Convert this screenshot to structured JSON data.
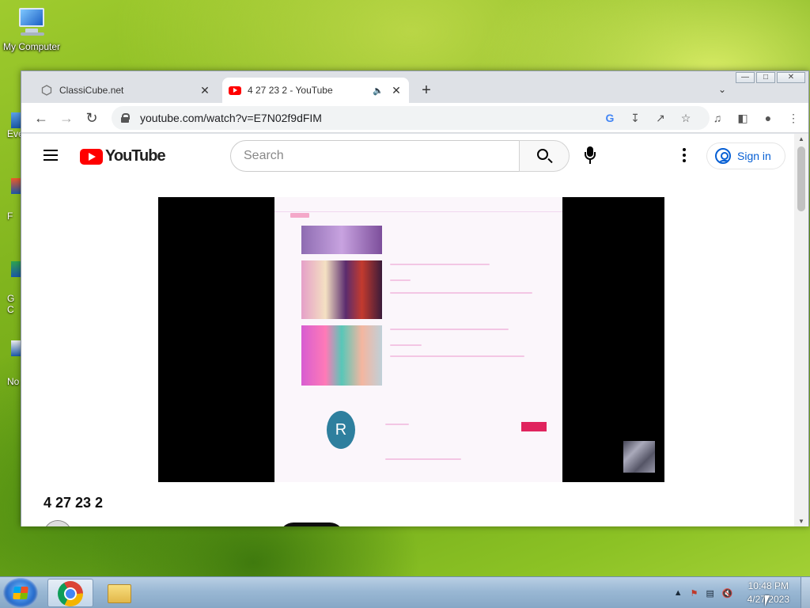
{
  "desktop": {
    "icons": [
      {
        "label": "My Computer"
      },
      {
        "label": "Eve"
      },
      {
        "label": "F"
      },
      {
        "label": "G\nC"
      },
      {
        "label": "No"
      }
    ]
  },
  "browser": {
    "tabs": [
      {
        "title": "ClassiCube.net",
        "active": false
      },
      {
        "title": "4 27 23 2 - YouTube",
        "active": true
      }
    ],
    "url": "youtube.com/watch?v=E7N02f9dFIM"
  },
  "youtube": {
    "logo_text": "YouTube",
    "search_placeholder": "Search",
    "signin_label": "Sign in",
    "video_title": "4 27 23 2",
    "video_frame_avatar_letter": "R"
  },
  "taskbar": {
    "time": "10:48 PM",
    "date": "4/27/2023"
  },
  "colors": {
    "youtube_red": "#ff0000",
    "link_blue": "#065fd4"
  }
}
